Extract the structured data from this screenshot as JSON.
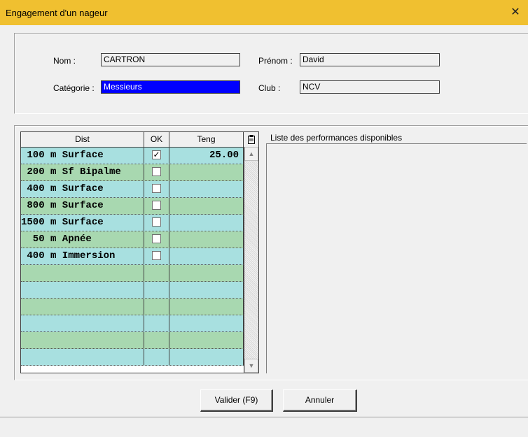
{
  "window": {
    "title": "Engagement d'un nageur",
    "close_glyph": "✕"
  },
  "swimmer": {
    "nom_label": "Nom :",
    "nom_value": "CARTRON",
    "prenom_label": "Prénom :",
    "prenom_value": "David",
    "categorie_label": "Catégorie :",
    "categorie_value": "Messieurs",
    "club_label": "Club :",
    "club_value": "NCV"
  },
  "grid": {
    "columns": {
      "dist": "Dist",
      "ok": "OK",
      "teng": "Teng",
      "menu_icon": "clipboard-icon"
    },
    "rows": [
      {
        "dist": " 100 m Surface",
        "ok": true,
        "teng": "25.00"
      },
      {
        "dist": " 200 m Sf Bipalme",
        "ok": false,
        "teng": ""
      },
      {
        "dist": " 400 m Surface",
        "ok": false,
        "teng": ""
      },
      {
        "dist": " 800 m Surface",
        "ok": false,
        "teng": ""
      },
      {
        "dist": "1500 m Surface",
        "ok": false,
        "teng": ""
      },
      {
        "dist": "  50 m Apnée",
        "ok": false,
        "teng": ""
      },
      {
        "dist": " 400 m Immersion",
        "ok": false,
        "teng": ""
      },
      {
        "dist": "",
        "ok": null,
        "teng": ""
      },
      {
        "dist": "",
        "ok": null,
        "teng": ""
      },
      {
        "dist": "",
        "ok": null,
        "teng": ""
      },
      {
        "dist": "",
        "ok": null,
        "teng": ""
      },
      {
        "dist": "",
        "ok": null,
        "teng": ""
      },
      {
        "dist": "",
        "ok": null,
        "teng": ""
      }
    ],
    "row_colors": [
      "#a8e0e0",
      "#a8d8b0"
    ]
  },
  "performances": {
    "header": "Liste des performances disponibles"
  },
  "buttons": {
    "validate": "Valider (F9)",
    "cancel": "Annuler"
  },
  "colors": {
    "titlebar": "#f0c030",
    "selection": "#0000ff"
  }
}
